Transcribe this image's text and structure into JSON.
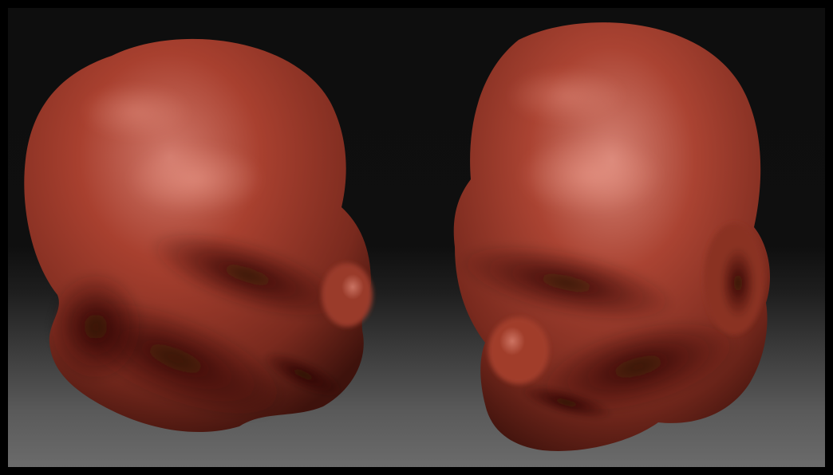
{
  "scene": {
    "background_top_color": "#0e0e0e",
    "background_bottom_color": "#6b6b6b",
    "clay_color": "#a8402f",
    "clay_highlight_color": "#d0786a",
    "clay_shadow_color": "#3e120c"
  },
  "models": [
    {
      "name": "head-sculpt-left-view"
    },
    {
      "name": "head-sculpt-right-view"
    }
  ]
}
